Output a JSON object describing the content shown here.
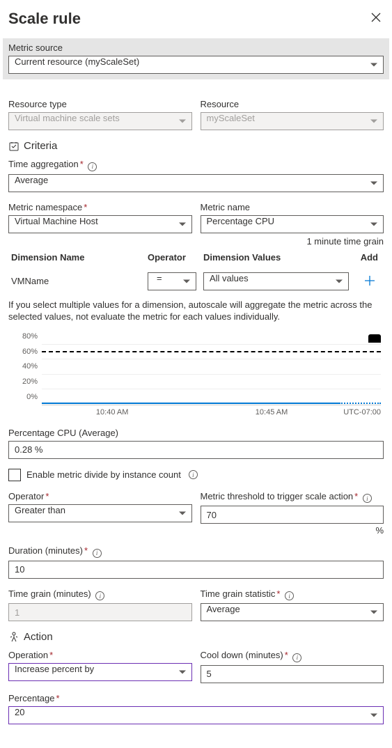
{
  "header": {
    "title": "Scale rule"
  },
  "metric_source": {
    "label": "Metric source",
    "value": "Current resource (myScaleSet)"
  },
  "resource_type": {
    "label": "Resource type",
    "value": "Virtual machine scale sets"
  },
  "resource": {
    "label": "Resource",
    "value": "myScaleSet"
  },
  "criteria": {
    "title": "Criteria",
    "time_aggregation": {
      "label": "Time aggregation",
      "value": "Average"
    },
    "metric_namespace": {
      "label": "Metric namespace",
      "value": "Virtual Machine Host"
    },
    "metric_name": {
      "label": "Metric name",
      "value": "Percentage CPU"
    },
    "time_grain_note": "1 minute time grain",
    "dimensions": {
      "headers": {
        "name": "Dimension Name",
        "operator": "Operator",
        "values": "Dimension Values",
        "add": "Add"
      },
      "rows": [
        {
          "name": "VMName",
          "operator": "=",
          "values": "All values"
        }
      ]
    },
    "help_text": "If you select multiple values for a dimension, autoscale will aggregate the metric across the selected values, not evaluate the metric for each values individually.",
    "chart_data": {
      "type": "line",
      "ylabel": "",
      "xlabel": "",
      "y_ticks": [
        "0%",
        "20%",
        "40%",
        "60%",
        "80%"
      ],
      "x_ticks": [
        "10:40 AM",
        "10:45 AM"
      ],
      "tz": "UTC-07:00",
      "threshold": 70,
      "series": [
        {
          "name": "Percentage CPU",
          "approx_value": 0.28,
          "display": "flat near 0%"
        }
      ],
      "ylim": [
        0,
        100
      ]
    },
    "current_metric": {
      "label": "Percentage CPU (Average)",
      "value": "0.28 %"
    },
    "divide_checkbox": {
      "label": "Enable metric divide by instance count",
      "checked": false
    },
    "operator": {
      "label": "Operator",
      "value": "Greater than"
    },
    "threshold": {
      "label": "Metric threshold to trigger scale action",
      "value": "70",
      "unit": "%"
    },
    "duration": {
      "label": "Duration (minutes)",
      "value": "10"
    },
    "time_grain_minutes": {
      "label": "Time grain (minutes)",
      "value": "1"
    },
    "time_grain_statistic": {
      "label": "Time grain statistic",
      "value": "Average"
    }
  },
  "action": {
    "title": "Action",
    "operation": {
      "label": "Operation",
      "value": "Increase percent by"
    },
    "cooldown": {
      "label": "Cool down (minutes)",
      "value": "5"
    },
    "percentage": {
      "label": "Percentage",
      "value": "20"
    }
  }
}
